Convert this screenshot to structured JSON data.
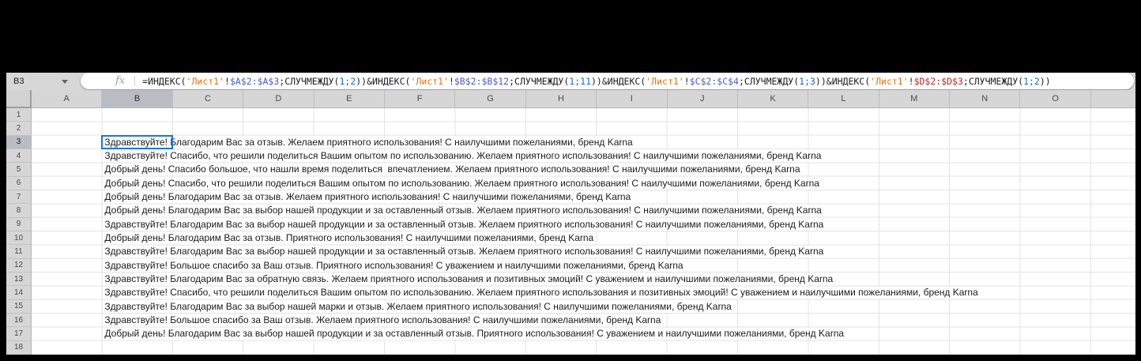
{
  "name_box": {
    "value": "B3"
  },
  "formula_bar": {
    "fx_label": "fx",
    "segments": [
      {
        "t": "=ИНДЕКС(",
        "c": "d"
      },
      {
        "t": "'Лист1'",
        "c": "s"
      },
      {
        "t": "!",
        "c": "d"
      },
      {
        "t": "$A$2:$A$3",
        "c": "r"
      },
      {
        "t": ";СЛУЧМЕЖДУ(",
        "c": "d"
      },
      {
        "t": "1;2",
        "c": "n"
      },
      {
        "t": "))&ИНДЕКС(",
        "c": "d"
      },
      {
        "t": "'Лист1'",
        "c": "s"
      },
      {
        "t": "!",
        "c": "d"
      },
      {
        "t": "$B$2:$B$12",
        "c": "r"
      },
      {
        "t": ";СЛУЧМЕЖДУ(",
        "c": "d"
      },
      {
        "t": "1;11",
        "c": "n"
      },
      {
        "t": "))&ИНДЕКС(",
        "c": "d"
      },
      {
        "t": "'Лист1'",
        "c": "s"
      },
      {
        "t": "!",
        "c": "d"
      },
      {
        "t": "$C$2:$C$4",
        "c": "r"
      },
      {
        "t": ";СЛУЧМЕЖДУ(",
        "c": "d"
      },
      {
        "t": "1;3",
        "c": "n"
      },
      {
        "t": "))&ИНДЕКС(",
        "c": "d"
      },
      {
        "t": "'Лист1'",
        "c": "s"
      },
      {
        "t": "!",
        "c": "d"
      },
      {
        "t": "$D$2:$D$3",
        "c": "r2"
      },
      {
        "t": ";СЛУЧМЕЖДУ(",
        "c": "d"
      },
      {
        "t": "1;2",
        "c": "n"
      },
      {
        "t": "))",
        "c": "d"
      }
    ]
  },
  "colors": {
    "d": "#202124",
    "s": "#e8710a",
    "r": "#4a5bd0",
    "r2": "#c5221f",
    "n": "#1967d2",
    "selection": "#1a73e8"
  },
  "grid": {
    "column_headers": [
      "A",
      "B",
      "C",
      "D",
      "E",
      "F",
      "G",
      "H",
      "I",
      "J",
      "K",
      "L",
      "M",
      "N",
      "O"
    ],
    "selected_column": "B",
    "selected_row": 3,
    "rows": [
      {
        "num": "1",
        "text": ""
      },
      {
        "num": "2",
        "text": ""
      },
      {
        "num": "3",
        "text": "Здравствуйте! Благодарим Вас за отзыв. Желаем приятного использования! С наилучшими пожеланиями, бренд Karna"
      },
      {
        "num": "4",
        "text": "Здравствуйте! Спасибо, что решили поделиться Вашим опытом по использованию. Желаем приятного использования! С наилучшими пожеланиями, бренд Karna"
      },
      {
        "num": "5",
        "text": "Добрый день! Спасибо большое, что нашли время поделиться  впечатлением. Желаем приятного использования! С наилучшими пожеланиями, бренд Karna"
      },
      {
        "num": "6",
        "text": "Добрый день! Спасибо, что решили поделиться Вашим опытом по использованию. Желаем приятного использования! С наилучшими пожеланиями, бренд Karna"
      },
      {
        "num": "7",
        "text": "Добрый день! Благодарим Вас за отзыв. Желаем приятного использования! С наилучшими пожеланиями, бренд Karna"
      },
      {
        "num": "8",
        "text": "Добрый день! Благодарим Вас за выбор нашей продукции и за оставленный отзыв. Желаем приятного использования! С наилучшими пожеланиями, бренд Karna"
      },
      {
        "num": "9",
        "text": "Здравствуйте! Благодарим Вас за выбор нашей продукции и за оставленный отзыв. Желаем приятного использования! С наилучшими пожеланиями, бренд Karna"
      },
      {
        "num": "10",
        "text": "Добрый день! Благодарим Вас за отзыв. Приятного использования! С наилучшими пожеланиями, бренд Karna"
      },
      {
        "num": "11",
        "text": "Здравствуйте! Благодарим Вас за выбор нашей продукции и за оставленный отзыв. Желаем приятного использования! С наилучшими пожеланиями, бренд Karna"
      },
      {
        "num": "12",
        "text": "Здравствуйте! Большое спасибо за Ваш отзыв. Приятного использования! С уважением и наилучшими пожеланиями, бренд Karna"
      },
      {
        "num": "13",
        "text": "Здравствуйте! Благодарим Вас за обратную связь. Желаем приятного использования и позитивных эмоций! С уважением и наилучшими пожеланиями, бренд Karna"
      },
      {
        "num": "14",
        "text": "Здравствуйте! Спасибо, что решили поделиться Вашим опытом по использованию. Желаем приятного использования и позитивных эмоций! С уважением и наилучшими пожеланиями, бренд Karna"
      },
      {
        "num": "15",
        "text": "Здравствуйте! Благодарим Вас за выбор нашей марки и отзыв. Желаем приятного использования! С наилучшими пожеланиями, бренд Karna"
      },
      {
        "num": "16",
        "text": "Здравствуйте! Большое спасибо за Ваш отзыв. Желаем приятного использования! С наилучшими пожеланиями, бренд Karna"
      },
      {
        "num": "17",
        "text": "Добрый день! Благодарим Вас за выбор нашей продукции и за оставленный отзыв. Приятного использования! С уважением и наилучшими пожеланиями, бренд Karna"
      },
      {
        "num": "18",
        "text": ""
      }
    ]
  }
}
